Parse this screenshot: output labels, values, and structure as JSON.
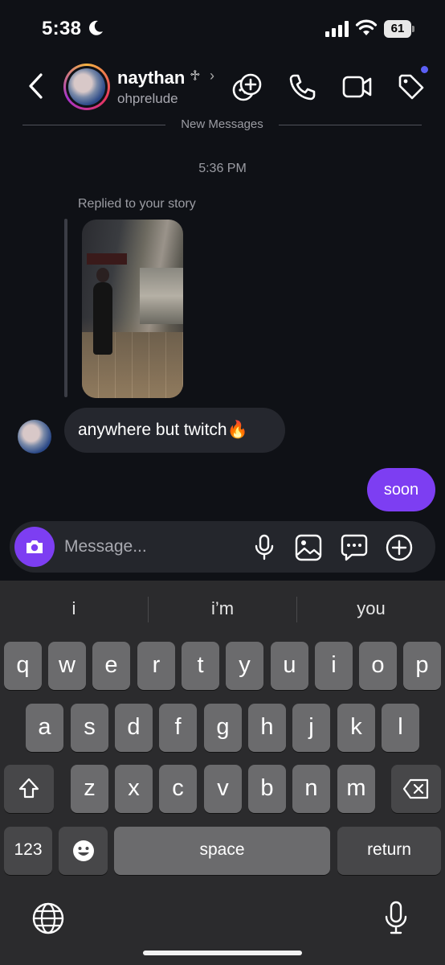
{
  "status_bar": {
    "time": "5:38",
    "battery": "61",
    "icons": [
      "moon-icon",
      "signal-icon",
      "wifi-icon",
      "battery-icon"
    ]
  },
  "header": {
    "name": "naythan",
    "badge": "♱",
    "chevron": "›",
    "handle": "ohprelude",
    "icons": [
      "back-icon",
      "effects-icon",
      "phone-icon",
      "video-icon",
      "tag-icon"
    ],
    "notification_color": "#5b5ff5"
  },
  "messages": {
    "divider": "New Messages",
    "timestamp": "5:36 PM",
    "replied_label": "Replied to your story",
    "incoming_text": "anywhere but twitch",
    "incoming_emoji": "🔥",
    "outgoing_text": "soon"
  },
  "composer": {
    "placeholder": "Message...",
    "icons": [
      "camera-icon",
      "microphone-icon",
      "gallery-icon",
      "sticker-icon",
      "plus-icon"
    ]
  },
  "keyboard": {
    "suggestions": [
      "i",
      "i’m",
      "you"
    ],
    "row1": [
      "q",
      "w",
      "e",
      "r",
      "t",
      "y",
      "u",
      "i",
      "o",
      "p"
    ],
    "row2": [
      "a",
      "s",
      "d",
      "f",
      "g",
      "h",
      "j",
      "k",
      "l"
    ],
    "row3": [
      "z",
      "x",
      "c",
      "v",
      "b",
      "n",
      "m"
    ],
    "numbers_key": "123",
    "space_key": "space",
    "return_key": "return",
    "icons": [
      "shift-icon",
      "backspace-icon",
      "emoji-icon",
      "globe-icon",
      "dictation-icon"
    ]
  },
  "colors": {
    "accent": "#7d3ef2",
    "background": "#0f1116",
    "bubble_in": "#25272e"
  }
}
